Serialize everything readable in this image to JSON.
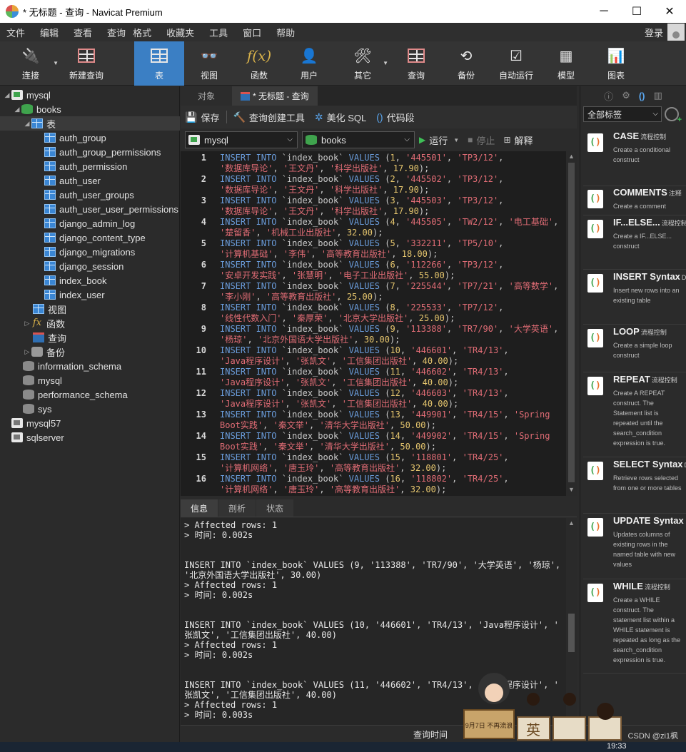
{
  "window": {
    "title": "* 无标题 - 查询 - Navicat Premium",
    "controls": [
      "─",
      "☐",
      "✕"
    ]
  },
  "menu": {
    "items": [
      "文件",
      "编辑",
      "查看",
      "查询",
      "格式",
      "收藏夹",
      "工具",
      "窗口",
      "帮助"
    ],
    "login": "登录"
  },
  "toolbar": {
    "buttons": [
      {
        "label": "连接",
        "icon": "plug-icon"
      },
      {
        "label": "新建查询",
        "icon": "new-query-icon"
      },
      {
        "label": "表",
        "icon": "table-icon"
      },
      {
        "label": "视图",
        "icon": "view-icon"
      },
      {
        "label": "函数",
        "icon": "function-icon"
      },
      {
        "label": "用户",
        "icon": "user-icon"
      },
      {
        "label": "其它",
        "icon": "tools-icon"
      },
      {
        "label": "查询",
        "icon": "query-icon"
      },
      {
        "label": "备份",
        "icon": "backup-icon"
      },
      {
        "label": "自动运行",
        "icon": "schedule-icon"
      },
      {
        "label": "模型",
        "icon": "model-icon"
      },
      {
        "label": "图表",
        "icon": "chart-icon"
      }
    ],
    "active": "表"
  },
  "tree": {
    "connection": "mysql",
    "database": "books",
    "tables_folder": "表",
    "tables": [
      "auth_group",
      "auth_group_permissions",
      "auth_permission",
      "auth_user",
      "auth_user_groups",
      "auth_user_user_permissions",
      "django_admin_log",
      "django_content_type",
      "django_migrations",
      "django_session",
      "index_book",
      "index_user"
    ],
    "views_folder": "视图",
    "functions_folder": "函数",
    "queries_folder": "查询",
    "backups_folder": "备份",
    "other_databases": [
      "information_schema",
      "mysql",
      "performance_schema",
      "sys"
    ],
    "other_connections": [
      "mysql57",
      "sqlserver"
    ]
  },
  "tabs": {
    "objects": "对象",
    "query": "* 无标题 - 查询"
  },
  "editor_toolbar": {
    "save": "保存",
    "query_builder": "查询创建工具",
    "beautify": "美化 SQL",
    "snippet": "代码段"
  },
  "selectors": {
    "connection": "mysql",
    "database": "books",
    "run": "运行",
    "stop": "停止",
    "explain": "解释"
  },
  "code_lines": [
    {
      "n": "1",
      "id": 1,
      "isbn": "445501",
      "code": "TP3/12",
      "title": "数据库导论",
      "author": "王文丹",
      "pub": "科学出版社",
      "price": "17.90",
      "wrap_at": "title"
    },
    {
      "n": "2",
      "id": 2,
      "isbn": "445502",
      "code": "TP3/12",
      "title": "数据库导论",
      "author": "王文丹",
      "pub": "科学出版社",
      "price": "17.90",
      "wrap_at": "title"
    },
    {
      "n": "3",
      "id": 3,
      "isbn": "445503",
      "code": "TP3/12",
      "title": "数据库导论",
      "author": "王文丹",
      "pub": "科学出版社",
      "price": "17.90",
      "wrap_at": "title"
    },
    {
      "n": "4",
      "id": 4,
      "isbn": "445505",
      "code": "TW2/12",
      "title": "电工基础",
      "author": "楚留香",
      "pub": "机械工业出版社",
      "price": "32.00",
      "wrap_at": "author"
    },
    {
      "n": "5",
      "id": 5,
      "isbn": "332211",
      "code": "TP5/10",
      "title": "计算机基础",
      "author": "李伟",
      "pub": "高等教育出版社",
      "price": "18.00",
      "wrap_at": "title"
    },
    {
      "n": "6",
      "id": 6,
      "isbn": "112266",
      "code": "TP3/12",
      "title": "安卓开发实践",
      "author": "张慧明",
      "pub": "电子工业出版社",
      "price": "55.00",
      "wrap_at": "title"
    },
    {
      "n": "7",
      "id": 7,
      "isbn": "225544",
      "code": "TP7/21",
      "title": "高等数学",
      "author": "李小刚",
      "pub": "高等教育出版社",
      "price": "25.00",
      "wrap_at": "author"
    },
    {
      "n": "8",
      "id": 8,
      "isbn": "225533",
      "code": "TP7/12",
      "title": "线性代数入门",
      "author": "秦厚荣",
      "pub": "北京大学出版社",
      "price": "25.00",
      "wrap_at": "title"
    },
    {
      "n": "9",
      "id": 9,
      "isbn": "113388",
      "code": "TR7/90",
      "title": "大学英语",
      "author": "杨琼",
      "pub": "北京外国语大学出版社",
      "price": "30.00",
      "wrap_at": "author"
    },
    {
      "n": "10",
      "id": 10,
      "isbn": "446601",
      "code": "TR4/13",
      "title": "Java程序设计",
      "author": "张凯文",
      "pub": "工信集团出版社",
      "price": "40.00",
      "wrap_at": "title"
    },
    {
      "n": "11",
      "id": 11,
      "isbn": "446602",
      "code": "TR4/13",
      "title": "Java程序设计",
      "author": "张凯文",
      "pub": "工信集团出版社",
      "price": "40.00",
      "wrap_at": "title"
    },
    {
      "n": "12",
      "id": 12,
      "isbn": "446603",
      "code": "TR4/13",
      "title": "Java程序设计",
      "author": "张凯文",
      "pub": "工信集团出版社",
      "price": "40.00",
      "wrap_at": "title"
    },
    {
      "n": "13",
      "id": 13,
      "isbn": "449901",
      "code": "TR4/15",
      "title": "Spring Boot实践",
      "author": "秦文举",
      "pub": "清华大学出版社",
      "price": "50.00",
      "wrap_at": "split"
    },
    {
      "n": "14",
      "id": 14,
      "isbn": "449902",
      "code": "TR4/15",
      "title": "Spring Boot实践",
      "author": "秦文举",
      "pub": "清华大学出版社",
      "price": "50.00",
      "wrap_at": "split"
    },
    {
      "n": "15",
      "id": 15,
      "isbn": "118801",
      "code": "TR4/25",
      "title": "计算机网络",
      "author": "唐玉玲",
      "pub": "高等教育出版社",
      "price": "32.00",
      "wrap_at": "title"
    },
    {
      "n": "16",
      "id": 16,
      "isbn": "118802",
      "code": "TR4/25",
      "title": "计算机网络",
      "author": "唐玉玲",
      "pub": "高等教育出版社",
      "price": "32.00",
      "wrap_at": "title"
    }
  ],
  "output_tabs": [
    "信息",
    "剖析",
    "状态"
  ],
  "output_lines": [
    "> Affected rows: 1",
    "> 时间: 0.002s",
    "",
    "",
    "INSERT INTO `index_book` VALUES (9, '113388', 'TR7/90', '大学英语', '杨琼',",
    "'北京外国语大学出版社', 30.00)",
    "> Affected rows: 1",
    "> 时间: 0.002s",
    "",
    "",
    "INSERT INTO `index_book` VALUES (10, '446601', 'TR4/13', 'Java程序设计', '",
    "张凯文', '工信集团出版社', 40.00)",
    "> Affected rows: 1",
    "> 时间: 0.002s",
    "",
    "",
    "INSERT INTO `index_book` VALUES (11, '446602', 'TR4/13', 'Java程序设计', '",
    "张凯文', '工信集团出版社', 40.00)",
    "> Affected rows: 1",
    "> 时间: 0.003s"
  ],
  "statusbar": {
    "query_time": "查询时间"
  },
  "taskbar": {
    "clock": "19:33"
  },
  "right_panel": {
    "filter": "全部标签",
    "snippets": [
      {
        "title": "CASE",
        "tag": "流程控制",
        "desc": "Create a conditional construct"
      },
      {
        "title": "COMMENTS",
        "tag": "注释",
        "desc": "Create a comment"
      },
      {
        "title": "IF...ELSE...",
        "tag": "流程控制",
        "desc": "Create a IF...ELSE... construct"
      },
      {
        "title": "INSERT Syntax",
        "tag": "DI",
        "desc": "Insert new rows into an existing table"
      },
      {
        "title": "LOOP",
        "tag": "流程控制",
        "desc": "Create a simple loop construct"
      },
      {
        "title": "REPEAT",
        "tag": "流程控制",
        "desc": "Create A REPEAT construct. The Statement list is repeated until the search_condition expression is true."
      },
      {
        "title": "SELECT Syntax",
        "tag": "DI",
        "desc": "Retrieve rows selected from one or more tables"
      },
      {
        "title": "UPDATE Syntax",
        "tag": "",
        "desc": "Updates columns of existing rows in the named table with new values"
      },
      {
        "title": "WHILE",
        "tag": "流程控制",
        "desc": "Create a WHILE construct. The statement list within a WHILE statement is repeated as long as the search_condition expression is true."
      }
    ]
  },
  "sticker": {
    "badge": "9月7日 不再流浪",
    "box_label": "英"
  },
  "watermark": "CSDN @zi1枫"
}
